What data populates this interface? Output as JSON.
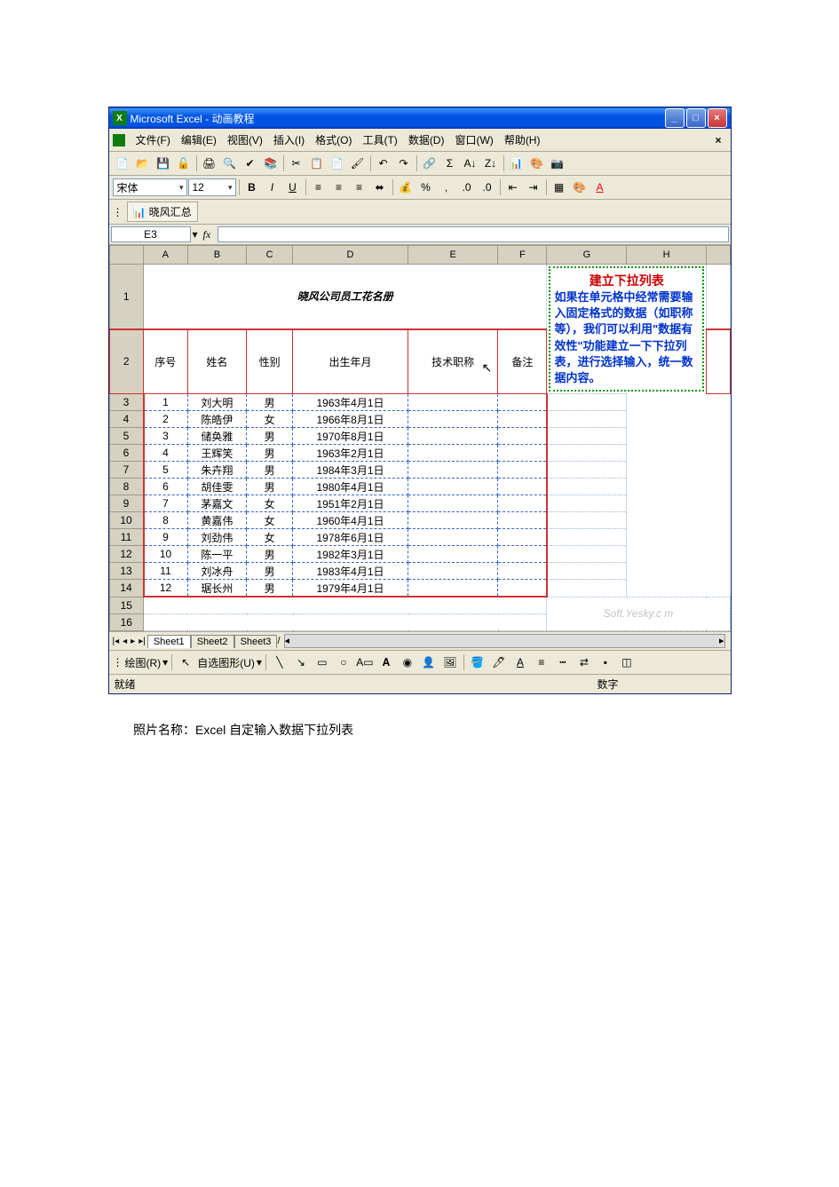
{
  "window": {
    "title": "Microsoft Excel - 动画教程",
    "min": "_",
    "max": "□",
    "close": "×"
  },
  "menu": {
    "file": "文件(F)",
    "edit": "编辑(E)",
    "view": "视图(V)",
    "insert": "插入(I)",
    "format": "格式(O)",
    "tools": "工具(T)",
    "data": "数据(D)",
    "window": "窗口(W)",
    "help": "帮助(H)"
  },
  "formatbar": {
    "font": "宋体",
    "size": "12"
  },
  "custom": {
    "button": "晓风汇总"
  },
  "namebox": "E3",
  "fx": "fx",
  "columns": [
    "A",
    "B",
    "C",
    "D",
    "E",
    "F",
    "G",
    "H"
  ],
  "rowcount": 16,
  "sheet_title": "晓风公司员工花名册",
  "headers": {
    "a": "序号",
    "b": "姓名",
    "c": "性别",
    "d": "出生年月",
    "e": "技术职称",
    "f": "备注"
  },
  "rows": [
    {
      "n": "1",
      "name": "刘大明",
      "sex": "男",
      "dob": "1963年4月1日"
    },
    {
      "n": "2",
      "name": "陈皓伊",
      "sex": "女",
      "dob": "1966年8月1日"
    },
    {
      "n": "3",
      "name": "储奂雅",
      "sex": "男",
      "dob": "1970年8月1日"
    },
    {
      "n": "4",
      "name": "王辉笑",
      "sex": "男",
      "dob": "1963年2月1日"
    },
    {
      "n": "5",
      "name": "朱卉翔",
      "sex": "男",
      "dob": "1984年3月1日"
    },
    {
      "n": "6",
      "name": "胡佳雯",
      "sex": "男",
      "dob": "1980年4月1日"
    },
    {
      "n": "7",
      "name": "茅嘉文",
      "sex": "女",
      "dob": "1951年2月1日"
    },
    {
      "n": "8",
      "name": "黄嘉伟",
      "sex": "女",
      "dob": "1960年4月1日"
    },
    {
      "n": "9",
      "name": "刘劲伟",
      "sex": "女",
      "dob": "1978年6月1日"
    },
    {
      "n": "10",
      "name": "陈一平",
      "sex": "男",
      "dob": "1982年3月1日"
    },
    {
      "n": "11",
      "name": "刘冰舟",
      "sex": "男",
      "dob": "1983年4月1日"
    },
    {
      "n": "12",
      "name": "琚长州",
      "sex": "男",
      "dob": "1979年4月1日"
    }
  ],
  "note": {
    "title": "建立下拉列表",
    "body": "如果在单元格中经常需要输入固定格式的数据（如职称等），我们可以利用\"数据有效性\"功能建立一下下拉列表，进行选择输入，统一数据内容。"
  },
  "watermark": "Soft.Yesky.c  m",
  "tabs": {
    "s1": "Sheet1",
    "s2": "Sheet2",
    "s3": "Sheet3"
  },
  "drawbar": {
    "label": "绘图(R)",
    "autoshape": "自选图形(U)"
  },
  "status": {
    "left": "就绪",
    "right": "数字"
  },
  "caption": "照片名称：Excel 自定输入数据下拉列表"
}
